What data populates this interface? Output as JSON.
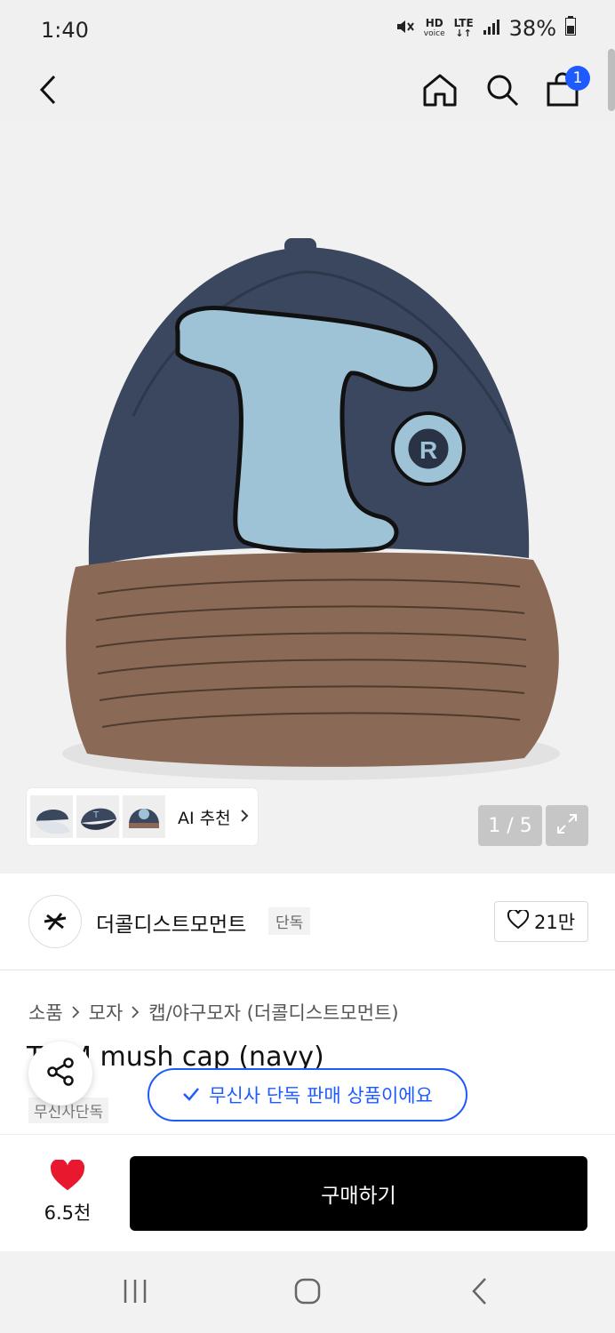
{
  "status": {
    "time": "1:40",
    "hd": "HD",
    "voice": "voice",
    "lte": "LTE",
    "battery": "38%"
  },
  "header": {
    "cart_count": "1"
  },
  "gallery": {
    "page_indicator": "1 / 5",
    "ai_label": "AI 추천"
  },
  "brand": {
    "name": "더콜디스트모먼트",
    "tag": "단독",
    "likes": "21만"
  },
  "breadcrumb": [
    "소품",
    "모자",
    "캡/야구모자 (더콜디스트모먼트)"
  ],
  "product": {
    "title": "TC M mush cap (navy)",
    "tag": "무신사단독"
  },
  "toast": {
    "text": "무신사 단독 판매 상품이에요"
  },
  "bottom": {
    "like_count": "6.5천",
    "buy_label": "구매하기"
  },
  "colors": {
    "accent_blue": "#1e5bff",
    "heart_red": "#e8182f",
    "cap_navy": "#3b475f",
    "cap_brim": "#8a6a56",
    "logo_blue": "#9fc3d6"
  },
  "icons": {
    "back": "chevron-left-icon",
    "home": "home-icon",
    "search": "search-icon",
    "cart": "shopping-bag-icon",
    "share": "share-icon",
    "heart": "heart-icon",
    "expand": "expand-icon",
    "check": "check-icon"
  }
}
